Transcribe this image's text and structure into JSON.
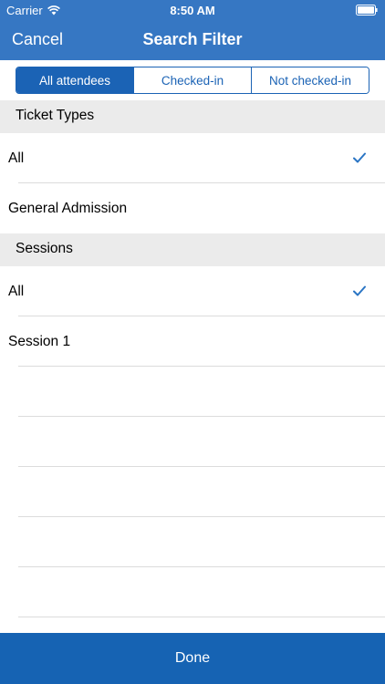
{
  "status_bar": {
    "carrier": "Carrier",
    "time": "8:50 AM",
    "wifi_icon": "wifi-icon",
    "battery_icon": "battery-icon"
  },
  "nav": {
    "cancel_label": "Cancel",
    "title": "Search Filter"
  },
  "segments": {
    "items": [
      {
        "label": "All attendees",
        "selected": true
      },
      {
        "label": "Checked-in",
        "selected": false
      },
      {
        "label": "Not checked-in",
        "selected": false
      }
    ]
  },
  "ticket_types": {
    "header": "Ticket Types",
    "rows": [
      {
        "label": "All",
        "checked": true
      },
      {
        "label": "General Admission",
        "checked": false
      }
    ]
  },
  "sessions": {
    "header": "Sessions",
    "rows": [
      {
        "label": "All",
        "checked": true
      },
      {
        "label": "Session 1",
        "checked": false
      }
    ]
  },
  "done_label": "Done",
  "colors": {
    "header_blue": "#3677c3",
    "accent_blue": "#1b63b5",
    "done_blue": "#1663b3",
    "checkmark": "#2a75c4",
    "section_bg": "#ebebeb"
  },
  "icons": {
    "checkmark": "checkmark-icon"
  }
}
